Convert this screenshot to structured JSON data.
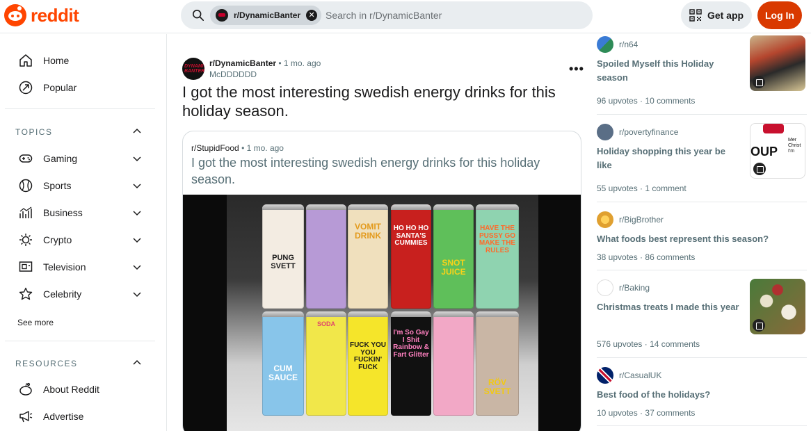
{
  "header": {
    "logo_text": "reddit",
    "search_chip": "r/DynamicBanter",
    "search_placeholder": "Search in r/DynamicBanter",
    "get_app": "Get app",
    "login": "Log In"
  },
  "sidebar": {
    "main": [
      {
        "label": "Home",
        "icon": "home-icon"
      },
      {
        "label": "Popular",
        "icon": "popular-icon"
      }
    ],
    "topics_title": "TOPICS",
    "topics": [
      {
        "label": "Gaming",
        "icon": "gamepad-icon"
      },
      {
        "label": "Sports",
        "icon": "ball-icon"
      },
      {
        "label": "Business",
        "icon": "chart-icon"
      },
      {
        "label": "Crypto",
        "icon": "crypto-icon"
      },
      {
        "label": "Television",
        "icon": "tv-icon"
      },
      {
        "label": "Celebrity",
        "icon": "star-icon"
      }
    ],
    "see_more": "See more",
    "resources_title": "RESOURCES",
    "resources": [
      {
        "label": "About Reddit",
        "icon": "reddit-icon"
      },
      {
        "label": "Advertise",
        "icon": "megaphone-icon"
      }
    ]
  },
  "post": {
    "subreddit": "r/DynamicBanter",
    "avatar_text": "DYNAMIC BANTER",
    "age": "• 1 mo. ago",
    "author": "McDDDDDD",
    "more": "•••",
    "title": "I got the most interesting swedish energy drinks for this holiday season.",
    "crosspost": {
      "subreddit": "r/StupidFood",
      "age": "• 1 mo. ago",
      "title": "I got the most interesting swedish energy drinks for this holiday season."
    },
    "cans_top": [
      "PUNG SVETT",
      "",
      "VOMIT DRINK",
      "HO HO HO SANTA'S CUMMIES",
      "SNOT JUICE",
      "HAVE THE PUSSY GO MAKE THE RULES"
    ],
    "cans_bottom": [
      "CUM SAUCE",
      "SODA",
      "FUCK YOU YOU FUCKIN' FUCK",
      "I'm So Gay I Shit Rainbow & Fart Glitter",
      "",
      "RÖV SVETT"
    ]
  },
  "right_feed": [
    {
      "subreddit": "r/n64",
      "title": "Spoiled Myself this Holiday season",
      "upvotes": "96 upvotes",
      "comments": "10 comments",
      "colors": [
        "#3a7bd5",
        "#2e8b57"
      ]
    },
    {
      "subreddit": "r/povertyfinance",
      "title": "Holiday shopping this year be like",
      "upvotes": "55 upvotes",
      "comments": "1 comment",
      "colors": [
        "#5a6e86",
        "#c8102e"
      ]
    },
    {
      "subreddit": "r/BigBrother",
      "title": "What foods best represent this season?",
      "upvotes": "38 upvotes",
      "comments": "86 comments",
      "colors": [
        "#e0a030"
      ]
    },
    {
      "subreddit": "r/Baking",
      "title": "Christmas treats I made this year",
      "upvotes": "576 upvotes",
      "comments": "14 comments",
      "colors": [
        "#4a7a3a",
        "#b03030"
      ]
    },
    {
      "subreddit": "r/CasualUK",
      "title": "Best food of the holidays?",
      "upvotes": "10 upvotes",
      "comments": "37 comments",
      "colors": [
        "#012169",
        "#c8102e"
      ]
    }
  ],
  "thumb_texts": [
    "OUP",
    "Mer Christ I'm"
  ]
}
